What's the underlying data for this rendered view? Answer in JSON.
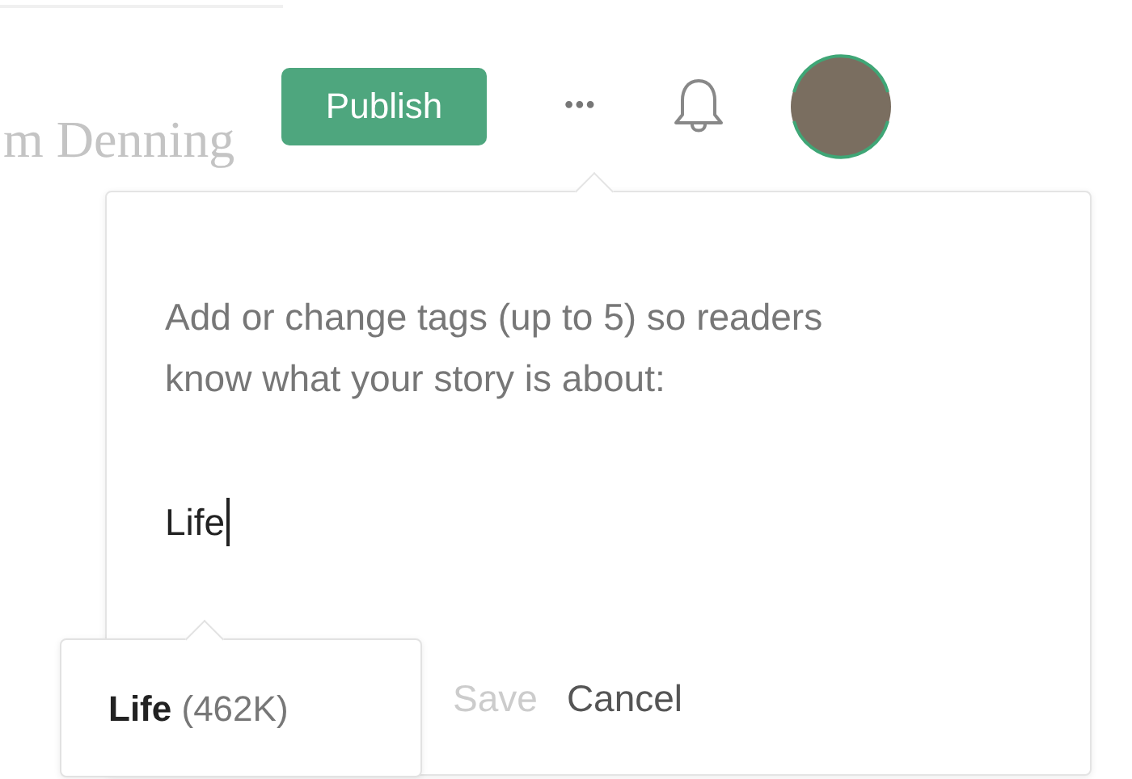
{
  "background_heading": "m Denning",
  "header": {
    "publish_button": "Publish",
    "more_button": "•••"
  },
  "tag_popover": {
    "instructions": "Add or change tags (up to 5) so readers know what your story is about:",
    "tag_input": "Life",
    "buttons": [
      {
        "label": "Save",
        "disabled": true
      },
      {
        "label": "Cancel",
        "disabled": false
      }
    ]
  },
  "suggestions": [
    {
      "name": "Life",
      "count": "(462K)"
    }
  ]
}
